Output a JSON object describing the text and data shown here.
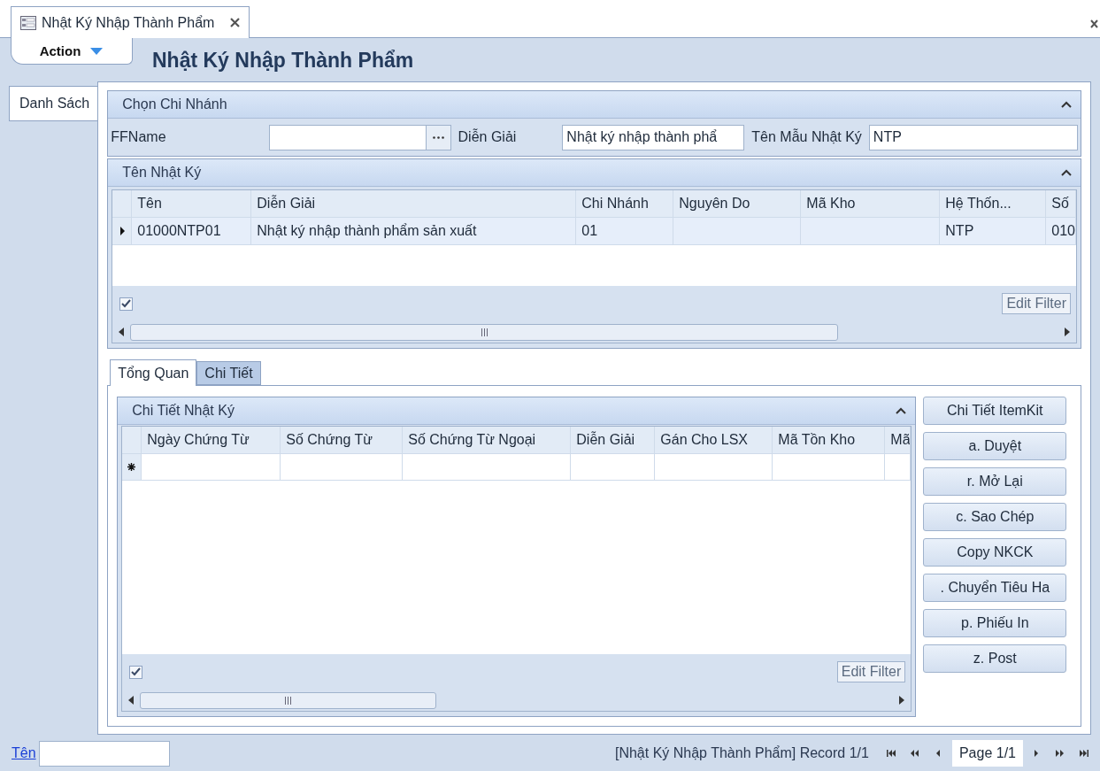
{
  "document_tabs": [
    {
      "label": "Nhật Ký Nhập Thành Phẩm",
      "selected": true
    }
  ],
  "action_menu": {
    "label": "Action"
  },
  "title": "Nhật Ký Nhập Thành Phẩm",
  "side_tabs": [
    {
      "label": "Danh Sách",
      "selected": true
    }
  ],
  "branch_group": {
    "title": "Chọn Chi Nhánh",
    "expanded": true,
    "fields": [
      {
        "kind": "lookup",
        "label": "FFName"
      },
      {
        "kind": "text",
        "label": "Diễn Giải",
        "value": "Nhật ký nhập thành phẩ"
      },
      {
        "kind": "text",
        "label": "Tên Mẫu Nhật Ký",
        "value": "NTP"
      }
    ]
  },
  "journal_group": {
    "title": "Tên Nhật Ký",
    "expanded": true,
    "columns": [
      "Tên",
      "Diễn Giải",
      "Chi Nhánh",
      "Nguyên Do",
      "Mã Kho",
      "Hệ Thốn...",
      "Số"
    ],
    "rows": [
      {
        "selected": true,
        "cells": [
          "01000NTP01",
          "Nhật ký nhập thành phẩm sản xuất",
          "01",
          "",
          "",
          "NTP",
          "010"
        ]
      }
    ],
    "filter_checked": true,
    "edit_filter": "Edit Filter"
  },
  "detail_tabs": [
    {
      "label": "Tổng Quan",
      "selected": true
    },
    {
      "label": "Chi Tiết",
      "selected": false
    }
  ],
  "detail_group": {
    "title": "Chi Tiết Nhật Ký",
    "expanded": true,
    "columns": [
      "Ngày Chứng Từ",
      "Số Chứng Từ",
      "Số Chứng Từ Ngoại",
      "Diễn Giải",
      "Gán Cho LSX",
      "Mã Tồn Kho",
      "Mã"
    ],
    "new_row": true,
    "filter_checked": true,
    "edit_filter": "Edit Filter"
  },
  "actions": [
    "Chi Tiết ItemKit",
    "a. Duyệt",
    "r. Mở Lại",
    "c. Sao Chép",
    "Copy NKCK",
    ". Chuyển Tiêu Ha",
    "p. Phiếu In",
    "z. Post"
  ],
  "footer": {
    "search_label": "Tên",
    "record": "[Nhật Ký Nhập Thành Phẩm] Record 1/1",
    "page": "Page 1/1"
  }
}
